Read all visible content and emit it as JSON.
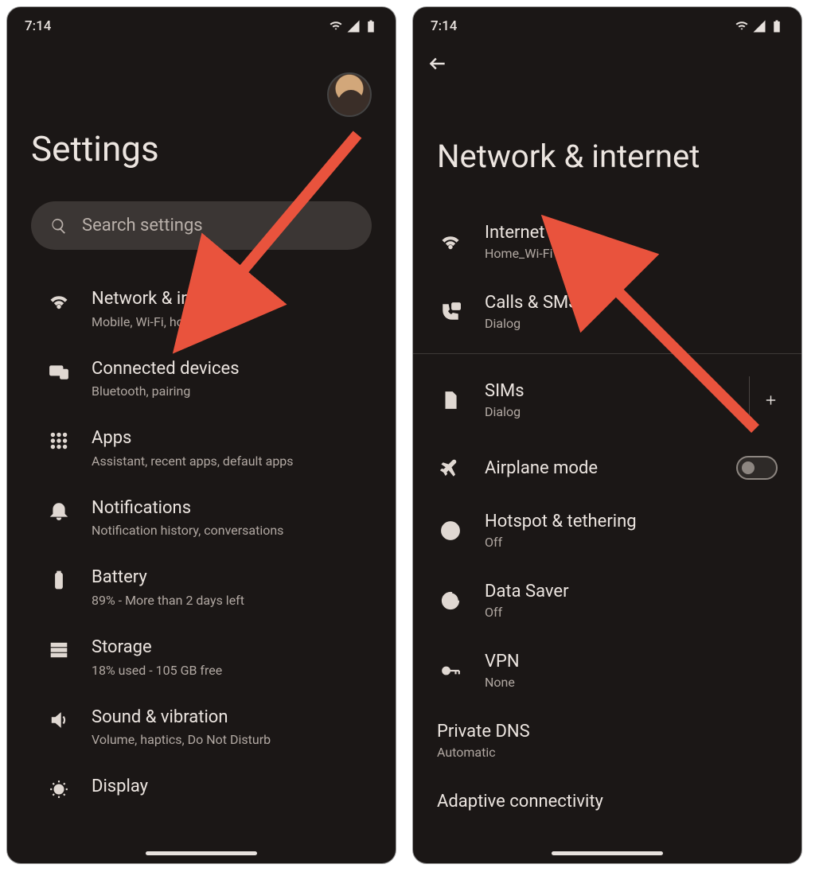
{
  "status": {
    "time": "7:14"
  },
  "left": {
    "title": "Settings",
    "searchPlaceholder": "Search settings",
    "items": [
      {
        "title": "Network & internet",
        "sub": "Mobile, Wi-Fi, hotspot"
      },
      {
        "title": "Connected devices",
        "sub": "Bluetooth, pairing"
      },
      {
        "title": "Apps",
        "sub": "Assistant, recent apps, default apps"
      },
      {
        "title": "Notifications",
        "sub": "Notification history, conversations"
      },
      {
        "title": "Battery",
        "sub": "89% - More than 2 days left"
      },
      {
        "title": "Storage",
        "sub": "18% used - 105 GB free"
      },
      {
        "title": "Sound & vibration",
        "sub": "Volume, haptics, Do Not Disturb"
      },
      {
        "title": "Display",
        "sub": ""
      }
    ]
  },
  "right": {
    "title": "Network & internet",
    "items": [
      {
        "title": "Internet",
        "sub": "Home_Wi-Fi"
      },
      {
        "title": "Calls & SMS",
        "sub": "Dialog"
      },
      {
        "title": "SIMs",
        "sub": "Dialog"
      },
      {
        "title": "Airplane mode",
        "sub": ""
      },
      {
        "title": "Hotspot & tethering",
        "sub": "Off"
      },
      {
        "title": "Data Saver",
        "sub": "Off"
      },
      {
        "title": "VPN",
        "sub": "None"
      },
      {
        "title": "Private DNS",
        "sub": "Automatic"
      },
      {
        "title": "Adaptive connectivity",
        "sub": ""
      }
    ]
  },
  "colors": {
    "arrow": "#e9533d"
  }
}
